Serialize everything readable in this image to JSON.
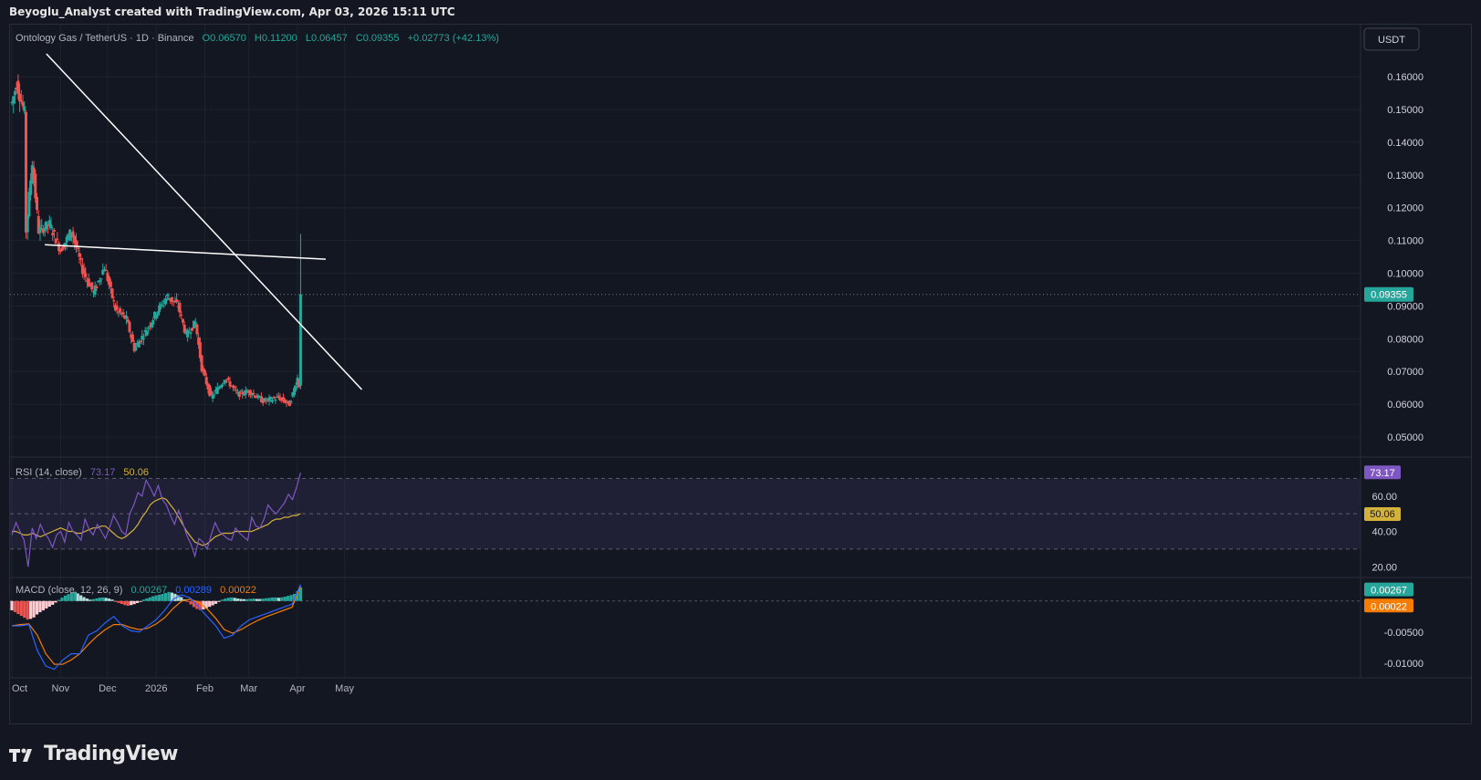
{
  "header": {
    "credit": "Beyoglu_Analyst created with TradingView.com, Apr 03, 2026 15:11 UTC"
  },
  "footer": {
    "brand": "TradingView"
  },
  "colors": {
    "background": "#131722",
    "up": "#26a69a",
    "down": "#ef5350",
    "rsi_line": "#7e57c2",
    "rsi_ma": "#d4b13b",
    "macd_line": "#2962ff",
    "signal_line": "#f57c00",
    "trendline": "#ffffff"
  },
  "legend": {
    "symbol": "Ontology Gas / TetherUS · 1D · Binance",
    "open": "O0.06570",
    "high": "H0.11200",
    "low": "L0.06457",
    "close": "C0.09355",
    "change": "+0.02773 (+42.13%)"
  },
  "currency": "USDT",
  "chart_data": [
    {
      "type": "candlestick",
      "title": "Ontology Gas / TetherUS · 1D · Binance",
      "x_ticks": [
        "Oct",
        "Nov",
        "Dec",
        "2026",
        "Feb",
        "Mar",
        "Apr",
        "May"
      ],
      "y_ticks": [
        "0.16000",
        "0.15000",
        "0.14000",
        "0.13000",
        "0.12000",
        "0.11000",
        "0.10000",
        "0.09000",
        "0.08000",
        "0.07000",
        "0.06000",
        "0.05000"
      ],
      "ylim": [
        0.045,
        0.167
      ],
      "last_price": "0.09355",
      "last_candle": {
        "date": "Apr 03, 2026",
        "open": 0.0657,
        "high": 0.112,
        "low": 0.06457,
        "close": 0.09355
      },
      "close_path": [
        {
          "date": "2025-10-01",
          "close": 0.152
        },
        {
          "date": "2025-10-04",
          "close": 0.158
        },
        {
          "date": "2025-10-09",
          "close": 0.149
        },
        {
          "date": "2025-10-10",
          "close": 0.113
        },
        {
          "date": "2025-10-14",
          "close": 0.134
        },
        {
          "date": "2025-10-18",
          "close": 0.113
        },
        {
          "date": "2025-10-25",
          "close": 0.115
        },
        {
          "date": "2025-11-01",
          "close": 0.107
        },
        {
          "date": "2025-11-08",
          "close": 0.113
        },
        {
          "date": "2025-11-15",
          "close": 0.101
        },
        {
          "date": "2025-11-22",
          "close": 0.094
        },
        {
          "date": "2025-11-29",
          "close": 0.102
        },
        {
          "date": "2025-12-06",
          "close": 0.089
        },
        {
          "date": "2025-12-13",
          "close": 0.086
        },
        {
          "date": "2025-12-18",
          "close": 0.077
        },
        {
          "date": "2025-12-25",
          "close": 0.082
        },
        {
          "date": "2026-01-01",
          "close": 0.088
        },
        {
          "date": "2026-01-08",
          "close": 0.093
        },
        {
          "date": "2026-01-15",
          "close": 0.09
        },
        {
          "date": "2026-01-20",
          "close": 0.081
        },
        {
          "date": "2026-01-26",
          "close": 0.085
        },
        {
          "date": "2026-01-30",
          "close": 0.071
        },
        {
          "date": "2026-02-05",
          "close": 0.062
        },
        {
          "date": "2026-02-14",
          "close": 0.068
        },
        {
          "date": "2026-02-22",
          "close": 0.063
        },
        {
          "date": "2026-03-01",
          "close": 0.064
        },
        {
          "date": "2026-03-10",
          "close": 0.061
        },
        {
          "date": "2026-03-20",
          "close": 0.062
        },
        {
          "date": "2026-03-27",
          "close": 0.06
        },
        {
          "date": "2026-04-01",
          "close": 0.068
        },
        {
          "date": "2026-04-02",
          "close": 0.0657
        },
        {
          "date": "2026-04-03",
          "close": 0.09355
        }
      ],
      "trendlines": [
        {
          "name": "descending",
          "from": {
            "date": "2025-10-23",
            "value": 0.167
          },
          "to": {
            "date": "2026-05-12",
            "value": 0.0645
          }
        },
        {
          "name": "horizontal",
          "from": {
            "date": "2025-10-22",
            "value": 0.1087
          },
          "to": {
            "date": "2026-04-19",
            "value": 0.1043
          }
        }
      ]
    },
    {
      "type": "line",
      "title": "RSI (14, close)",
      "legend": [
        "73.17",
        "50.06"
      ],
      "y_ticks": [
        "60.00",
        "40.00",
        "20.00"
      ],
      "ylim": [
        15,
        80
      ],
      "bands": [
        70,
        50,
        30
      ],
      "last_values": {
        "rsi": "73.17",
        "rsi_ma": "50.06"
      },
      "series": [
        {
          "name": "RSI",
          "values": [
            38,
            45,
            40,
            35,
            20,
            42,
            36,
            44,
            39,
            36,
            31,
            38,
            40,
            34,
            45,
            40,
            38,
            35,
            47,
            41,
            38,
            44,
            40,
            36,
            42,
            49,
            45,
            40,
            38,
            50,
            55,
            62,
            60,
            69,
            65,
            60,
            66,
            58,
            55,
            49,
            44,
            52,
            45,
            38,
            33,
            26,
            36,
            34,
            30,
            38,
            45,
            40,
            38,
            36,
            35,
            42,
            39,
            37,
            35,
            48,
            43,
            42,
            47,
            55,
            52,
            50,
            53,
            56,
            61,
            58,
            65,
            73.17
          ]
        },
        {
          "name": "RSI MA",
          "values": [
            40,
            40,
            39,
            38,
            38,
            39,
            38,
            37,
            38,
            39,
            40,
            41,
            42,
            41,
            40,
            40,
            39,
            39,
            40,
            41,
            42,
            42,
            43,
            43,
            41,
            39,
            37,
            36,
            37,
            39,
            41,
            44,
            48,
            51,
            55,
            57,
            58,
            59,
            58,
            55,
            52,
            48,
            44,
            40,
            37,
            34,
            33,
            32,
            33,
            35,
            37,
            38,
            39,
            39,
            39,
            40,
            40,
            40,
            40,
            40,
            41,
            42,
            43,
            44,
            46,
            47,
            47,
            48,
            48,
            49,
            49,
            50.06
          ]
        }
      ]
    },
    {
      "type": "bar",
      "title": "MACD (close, 12, 26, 9)",
      "legend": [
        "0.00267",
        "0.00289",
        "0.00022"
      ],
      "y_ticks": [
        "-0.00500",
        "-0.01000"
      ],
      "ylim": [
        -0.0118,
        0.0035
      ],
      "last_values": {
        "macd": "0.00267",
        "histogram": "0.00022"
      },
      "series": [
        {
          "name": "Histogram",
          "values": [
            -0.0015,
            -0.002,
            -0.0025,
            -0.003,
            -0.0028,
            -0.002,
            -0.0015,
            -0.001,
            -0.0005,
            0.0002,
            0.0008,
            0.0012,
            0.0015,
            0.001,
            0.0005,
            0.0002,
            0.0004,
            0.0006,
            0.0005,
            0.0003,
            -0.0002,
            -0.0005,
            -0.0008,
            -0.0006,
            -0.0003,
            0.0002,
            0.0005,
            0.0008,
            0.001,
            0.0012,
            0.0015,
            0.0012,
            0.0008,
            0.0002,
            -0.0005,
            -0.0012,
            -0.0015,
            -0.0012,
            -0.0008,
            -0.0004,
            0.0002,
            0.0005,
            0.0006,
            0.0004,
            0.0003,
            0.0003,
            0.0004,
            0.0003,
            0.0004,
            0.0005,
            0.0006,
            0.0005,
            0.0007,
            0.0009,
            0.0012,
            0.0022
          ]
        },
        {
          "name": "MACD",
          "values": [
            -0.004,
            -0.004,
            -0.0038,
            -0.008,
            -0.0105,
            -0.011,
            -0.0095,
            -0.0085,
            -0.0085,
            -0.0055,
            -0.0048,
            -0.0035,
            -0.0025,
            -0.004,
            -0.0048,
            -0.005,
            -0.004,
            -0.003,
            -0.0015,
            0.0003,
            0.001,
            0.0005,
            -0.001,
            -0.0025,
            -0.004,
            -0.006,
            -0.0055,
            -0.004,
            -0.003,
            -0.0025,
            -0.002,
            -0.0015,
            -0.001,
            -0.0005,
            0.00267
          ]
        },
        {
          "name": "Signal",
          "values": [
            -0.004,
            -0.0038,
            -0.0037,
            -0.0055,
            -0.0085,
            -0.0102,
            -0.0102,
            -0.0095,
            -0.0085,
            -0.007,
            -0.0057,
            -0.0046,
            -0.0038,
            -0.0038,
            -0.0043,
            -0.0046,
            -0.0044,
            -0.0037,
            -0.0027,
            -0.0012,
            0.0,
            0.0003,
            -0.0002,
            -0.0013,
            -0.0028,
            -0.0046,
            -0.0052,
            -0.0046,
            -0.0038,
            -0.0031,
            -0.0025,
            -0.002,
            -0.0015,
            -0.001,
            0.00245
          ]
        }
      ]
    }
  ]
}
